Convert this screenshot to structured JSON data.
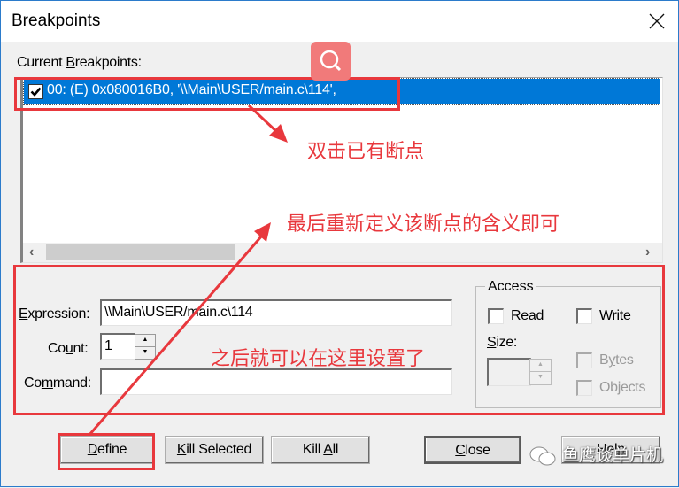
{
  "window": {
    "title": "Breakpoints",
    "close_icon": "close-x-icon"
  },
  "breakpoints": {
    "label_pre": "Current ",
    "label_ul": "B",
    "label_post": "reakpoints:",
    "items": [
      {
        "checked": true,
        "text": "00: (E) 0x080016B0,  '\\\\Main\\USER/main.c\\114',"
      }
    ]
  },
  "definition": {
    "expression": {
      "label_ul": "E",
      "label_post": "xpression:",
      "value": "\\\\Main\\USER/main.c\\114"
    },
    "count": {
      "label_pre": "Co",
      "label_ul": "u",
      "label_post": "nt:",
      "value": "1"
    },
    "command": {
      "label_pre": "Co",
      "label_ul": "m",
      "label_post": "mand:",
      "value": ""
    }
  },
  "access": {
    "title": "Access",
    "read": {
      "label_ul": "R",
      "label_post": "ead",
      "checked": false
    },
    "write": {
      "label_ul": "W",
      "label_post": "rite",
      "checked": false
    },
    "size": {
      "label_ul": "S",
      "label_post": "ize:",
      "value": ""
    },
    "bytes": {
      "label_pre": "B",
      "label_ul": "y",
      "label_post": "tes",
      "checked": false,
      "disabled": true
    },
    "objects": {
      "label": "Objects",
      "checked": false,
      "disabled": true
    }
  },
  "buttons": {
    "define": {
      "label_ul": "D",
      "label_post": "efine"
    },
    "kill_selected": {
      "label_ul": "K",
      "label_post": "ill Selected"
    },
    "kill_all": {
      "label_pre": "Kill ",
      "label_ul": "A",
      "label_post": "ll"
    },
    "close": {
      "label_ul": "C",
      "label_post": "lose"
    },
    "help": {
      "label": "Help"
    }
  },
  "annotations": {
    "double_click": "双击已有断点",
    "redefine": "最后重新定义该断点的含义即可",
    "set_here": "之后就可以在这里设置了",
    "accent_color": "#e8383d"
  },
  "watermark": {
    "text": "鱼鹰谈单片机",
    "icon": "wechat-icon"
  },
  "search_badge": {
    "icon": "search-icon",
    "color": "#f17a7a"
  },
  "colors": {
    "selection": "#0078d7",
    "dialog_bg": "#f0f0f0",
    "window_border": "#2b7bcb"
  }
}
